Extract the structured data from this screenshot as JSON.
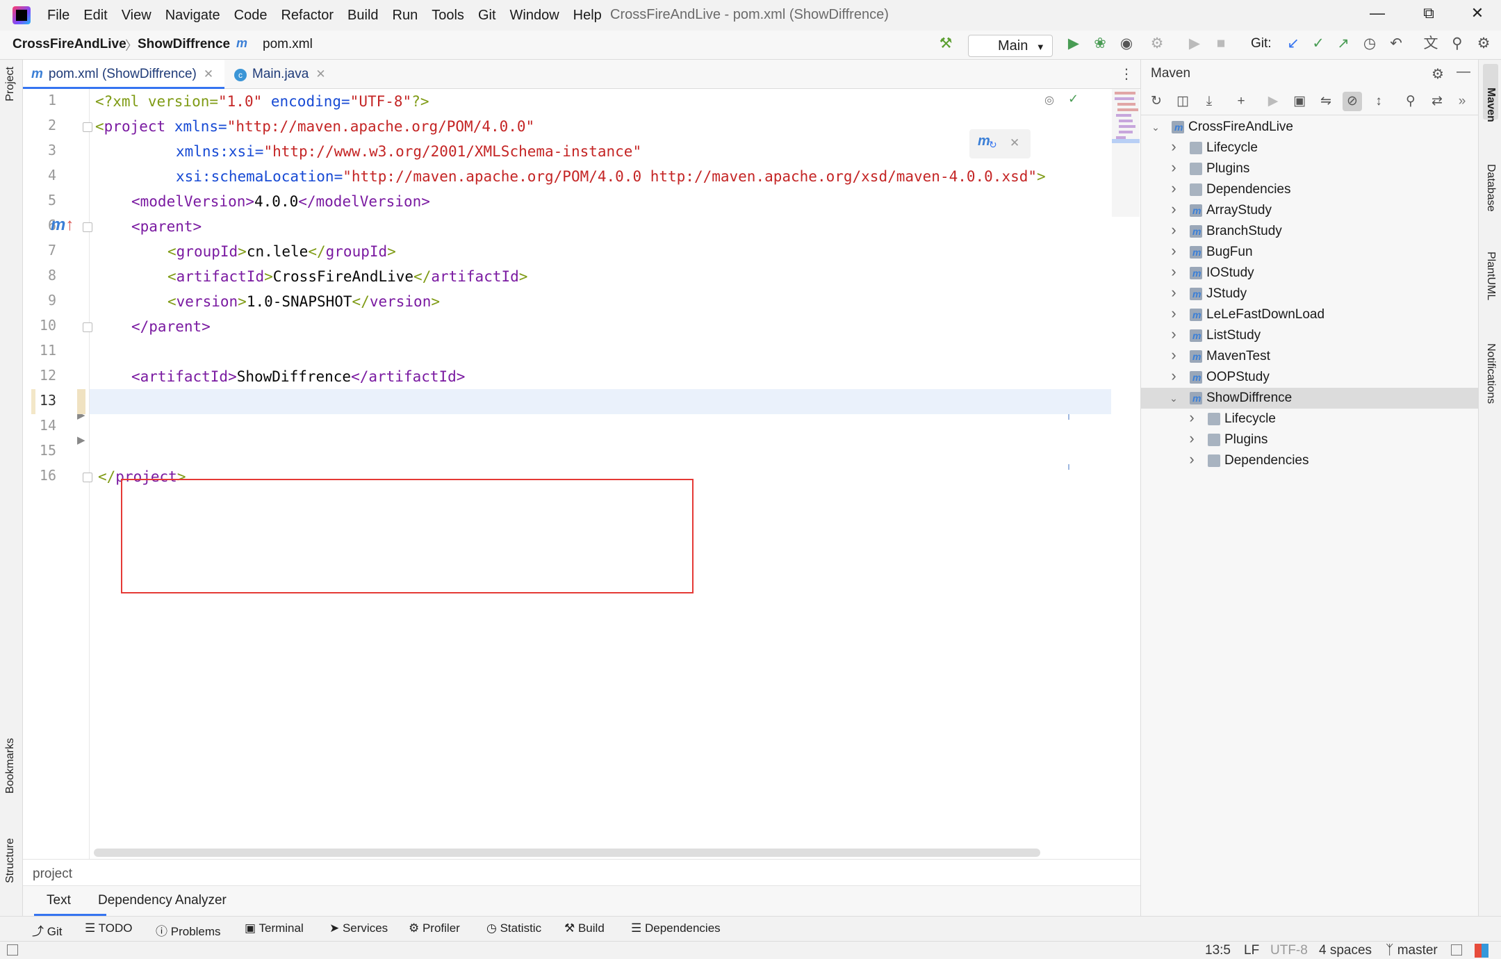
{
  "app": {
    "window_title": "CrossFireAndLive - pom.xml (ShowDiffrence)",
    "menu": [
      "File",
      "Edit",
      "View",
      "Navigate",
      "Code",
      "Refactor",
      "Build",
      "Run",
      "Tools",
      "Git",
      "Window",
      "Help"
    ]
  },
  "breadcrumb": {
    "project": "CrossFireAndLive",
    "module": "ShowDiffrence",
    "file": "pom.xml"
  },
  "toolbar": {
    "run_config": "Main",
    "git_label": "Git:"
  },
  "tabs": [
    {
      "label": "pom.xml (ShowDiffrence)",
      "active": true
    },
    {
      "label": "Main.java",
      "active": false
    }
  ],
  "editor": {
    "line_numbers": [
      "1",
      "2",
      "3",
      "4",
      "5",
      "6",
      "7",
      "8",
      "9",
      "10",
      "11",
      "12",
      "13",
      "14",
      "15",
      "16"
    ],
    "current_line": "13",
    "lines": {
      "l1": {
        "a": "<?xml version=",
        "b": "\"1.0\"",
        "c": " encoding=",
        "d": "\"UTF-8\"",
        "e": "?>"
      },
      "l2": {
        "a": "<",
        "b": "project",
        "c": " xmlns=",
        "d": "\"http://maven.apache.org/POM/4.0.0\""
      },
      "l3": {
        "a": "xmlns:xsi=",
        "b": "\"http://www.w3.org/2001/XMLSchema-instance\""
      },
      "l4": {
        "a": "xsi:schemaLocation=",
        "b": "\"http://maven.apache.org/POM/4.0.0 http://maven.apache.org/xsd/maven-4.0.0.xsd\"",
        "c": ">"
      },
      "l5": {
        "a": "<modelVersion>",
        "b": "4.0.0",
        "c": "</modelVersion>"
      },
      "l6": {
        "a": "<parent>"
      },
      "l7": {
        "a": "<",
        "b": "groupId",
        "c": ">",
        "d": "cn.lele",
        "e": "</",
        "f": "groupId",
        "g": ">"
      },
      "l8": {
        "a": "<",
        "b": "artifactId",
        "c": ">",
        "d": "CrossFireAndLive",
        "e": "</",
        "f": "artifactId",
        "g": ">"
      },
      "l9": {
        "a": "<",
        "b": "version",
        "c": ">",
        "d": "1.0-SNAPSHOT",
        "e": "</",
        "f": "version",
        "g": ">"
      },
      "l10": {
        "a": "</parent>"
      },
      "l12": {
        "a": "<artifactId>",
        "b": "ShowDiffrence",
        "c": "</artifactId>"
      },
      "l16": {
        "a": "</",
        "b": "project",
        "c": ">"
      }
    },
    "breadcrumb": "project",
    "bottom_tabs": [
      "Text",
      "Dependency Analyzer"
    ]
  },
  "maven": {
    "title": "Maven",
    "tree": [
      {
        "label": "CrossFireAndLive",
        "depth": 0,
        "open": true,
        "icon": "module",
        "selected": false
      },
      {
        "label": "Lifecycle",
        "depth": 1,
        "open": false,
        "icon": "folder-gear",
        "selected": false
      },
      {
        "label": "Plugins",
        "depth": 1,
        "open": false,
        "icon": "folder-gear",
        "selected": false
      },
      {
        "label": "Dependencies",
        "depth": 1,
        "open": false,
        "icon": "deps",
        "selected": false
      },
      {
        "label": "ArrayStudy",
        "depth": 1,
        "open": false,
        "icon": "module",
        "selected": false
      },
      {
        "label": "BranchStudy",
        "depth": 1,
        "open": false,
        "icon": "module",
        "selected": false
      },
      {
        "label": "BugFun",
        "depth": 1,
        "open": false,
        "icon": "module",
        "selected": false
      },
      {
        "label": "IOStudy",
        "depth": 1,
        "open": false,
        "icon": "module",
        "selected": false
      },
      {
        "label": "JStudy",
        "depth": 1,
        "open": false,
        "icon": "module",
        "selected": false
      },
      {
        "label": "LeLeFastDownLoad",
        "depth": 1,
        "open": false,
        "icon": "module",
        "selected": false
      },
      {
        "label": "ListStudy",
        "depth": 1,
        "open": false,
        "icon": "module",
        "selected": false
      },
      {
        "label": "MavenTest",
        "depth": 1,
        "open": false,
        "icon": "module",
        "selected": false
      },
      {
        "label": "OOPStudy",
        "depth": 1,
        "open": false,
        "icon": "module",
        "selected": false
      },
      {
        "label": "ShowDiffrence",
        "depth": 1,
        "open": true,
        "icon": "module",
        "selected": true
      },
      {
        "label": "Lifecycle",
        "depth": 2,
        "open": false,
        "icon": "folder-gear",
        "selected": false
      },
      {
        "label": "Plugins",
        "depth": 2,
        "open": false,
        "icon": "folder-gear",
        "selected": false
      },
      {
        "label": "Dependencies",
        "depth": 2,
        "open": false,
        "icon": "deps",
        "selected": false
      }
    ]
  },
  "left_strip": [
    "Project",
    "Bookmarks",
    "Structure"
  ],
  "right_strip": [
    "Maven",
    "Database",
    "PlantUML",
    "Notifications"
  ],
  "tool_windows": [
    "Git",
    "TODO",
    "Problems",
    "Terminal",
    "Services",
    "Profiler",
    "Statistic",
    "Build",
    "Dependencies"
  ],
  "status": {
    "position": "13:5",
    "line_sep": "LF",
    "encoding": "UTF-8",
    "indent": "4 spaces",
    "branch": "master"
  },
  "colors": {
    "accent": "#3574f0",
    "tag": "#7a1aa1",
    "string": "#c42525",
    "attr": "#174ad4",
    "highlight_box": "#e53935"
  }
}
